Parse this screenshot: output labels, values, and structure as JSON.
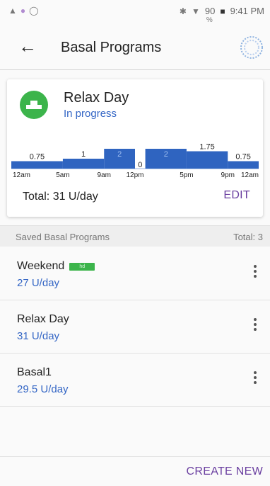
{
  "status_bar": {
    "icons_left": [
      "warning-icon",
      "dot-icon",
      "circle-icon"
    ],
    "icons_right": [
      "bluetooth-icon",
      "wifi-icon"
    ],
    "battery": "90",
    "battery_pct": "%",
    "time": "9:41 PM"
  },
  "header": {
    "title": "Basal Programs",
    "back_icon": "arrow-back-icon",
    "pump_icon": "pump-status-icon"
  },
  "active_program": {
    "name": "Relax Day",
    "status": "In progress",
    "icon": "basal-program-icon",
    "total": "Total: 31 U/day",
    "edit_label": "EDIT",
    "accent": "#3cb44b",
    "status_color": "#3466c5"
  },
  "chart_data": {
    "type": "bar",
    "title": "",
    "xlabel": "",
    "ylabel": "",
    "bar_color": "#2f64c0",
    "x_tick_labels": [
      "12am",
      "5am",
      "9am",
      "12pm",
      "5pm",
      "9pm",
      "12am"
    ],
    "segments": [
      {
        "start_hour": 0,
        "end_hour": 5,
        "rate": 0.75,
        "label": "0.75",
        "label_inside": false
      },
      {
        "start_hour": 5,
        "end_hour": 9,
        "rate": 1,
        "label": "1",
        "label_inside": false
      },
      {
        "start_hour": 9,
        "end_hour": 12,
        "rate": 2,
        "label": "2",
        "label_inside": true
      },
      {
        "start_hour": 12,
        "end_hour": 13,
        "rate": 0,
        "label": "0",
        "label_inside": false
      },
      {
        "start_hour": 13,
        "end_hour": 17,
        "rate": 2,
        "label": "2",
        "label_inside": true
      },
      {
        "start_hour": 17,
        "end_hour": 21,
        "rate": 1.75,
        "label": "1.75",
        "label_inside": false
      },
      {
        "start_hour": 21,
        "end_hour": 24,
        "rate": 0.75,
        "label": "0.75",
        "label_inside": false
      }
    ],
    "ylim": [
      0,
      2
    ]
  },
  "saved_section": {
    "title": "Saved Basal Programs",
    "total": "Total: 3"
  },
  "saved_programs": [
    {
      "name": "Weekend",
      "rate": "27 U/day",
      "badge": "hd",
      "badge_color": "#3cb44b"
    },
    {
      "name": "Relax Day",
      "rate": "31 U/day",
      "badge": null
    },
    {
      "name": "Basal1",
      "rate": "29.5 U/day",
      "badge": null
    }
  ],
  "footer": {
    "create_label": "CREATE NEW"
  }
}
